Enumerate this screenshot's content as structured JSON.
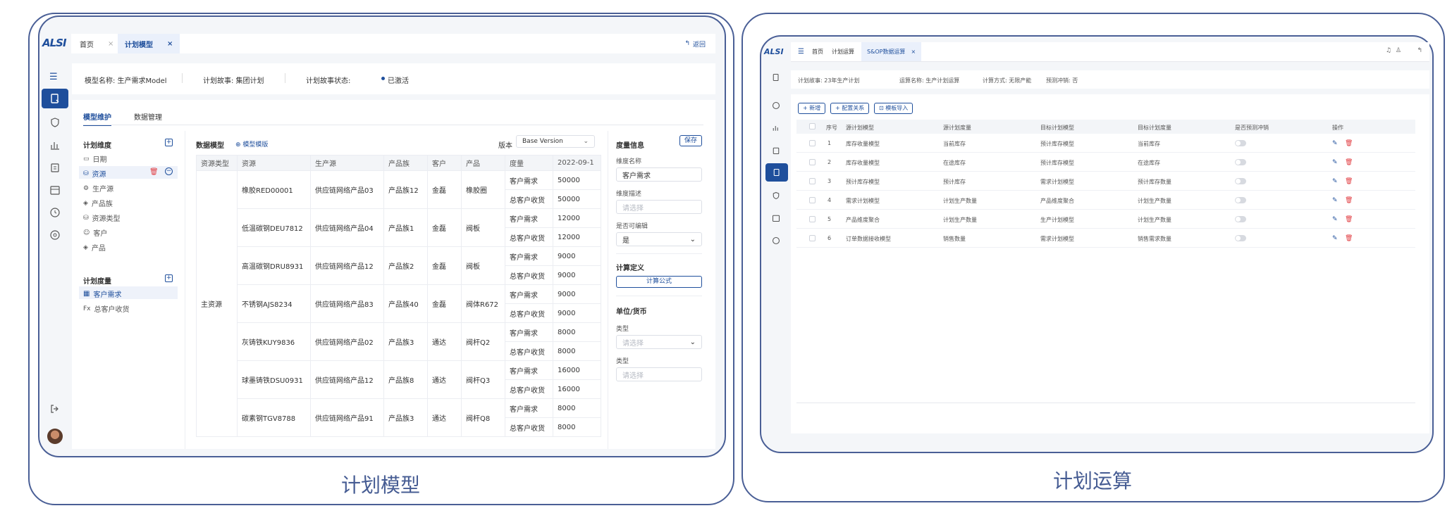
{
  "left": {
    "caption": "计划模型",
    "logo": "ALSI",
    "tabs": [
      {
        "label": "首页",
        "close": "×"
      },
      {
        "label": "计划模型",
        "close": "×"
      }
    ],
    "back_label": "返回",
    "info": {
      "model_name": "模型名称: 生产需求Model",
      "plan_story": "计划故事: 集团计划",
      "plan_status_label": "计划故事状态:",
      "plan_status_value": "已激活"
    },
    "subtabs": [
      "模型维护",
      "数据管理"
    ],
    "dimension": {
      "title": "计划维度",
      "items": [
        "日期",
        "资源",
        "生产源",
        "产品族",
        "资源类型",
        "客户",
        "产品"
      ],
      "icons": [
        "calendar-icon",
        "database-icon",
        "settings-icon",
        "tag-icon",
        "database-icon",
        "user-icon",
        "tag-icon"
      ]
    },
    "measure": {
      "title": "计划度量",
      "items": [
        "客户需求",
        "总客户收货"
      ],
      "prefix": [
        "",
        "Fx"
      ]
    },
    "data_model": {
      "title": "数据模型",
      "template_link": "模型模版",
      "version_label": "版本",
      "version_value": "Base Version",
      "columns": [
        "资源类型",
        "资源",
        "生产源",
        "产品族",
        "客户",
        "产品",
        "度量",
        "2022-09-1"
      ],
      "group_label": "主资源",
      "rows": [
        {
          "resource": "橡胶RED00001",
          "source": "供应链网络产品03",
          "family": "产品族12",
          "customer": "金磊",
          "product": "橡胶圈",
          "m1": "客户需求",
          "v1": "50000",
          "m2": "总客户收货",
          "v2": "50000"
        },
        {
          "resource": "低温碳钢DEU7812",
          "source": "供应链网络产品04",
          "family": "产品族1",
          "customer": "金磊",
          "product": "阀板",
          "m1": "客户需求",
          "v1": "12000",
          "m2": "总客户收货",
          "v2": "12000"
        },
        {
          "resource": "高温碳钢DRU8931",
          "source": "供应链网络产品12",
          "family": "产品族2",
          "customer": "金磊",
          "product": "阀板",
          "m1": "客户需求",
          "v1": "9000",
          "m2": "总客户收货",
          "v2": "9000"
        },
        {
          "resource": "不锈钢AJS8234",
          "source": "供应链网络产品83",
          "family": "产品族40",
          "customer": "金磊",
          "product": "阀体R672",
          "m1": "客户需求",
          "v1": "9000",
          "m2": "总客户收货",
          "v2": "9000"
        },
        {
          "resource": "灰铸铁KUY9836",
          "source": "供应链网络产品02",
          "family": "产品族3",
          "customer": "通达",
          "product": "阀杆Q2",
          "m1": "客户需求",
          "v1": "8000",
          "m2": "总客户收货",
          "v2": "8000"
        },
        {
          "resource": "球墨铸铁DSU0931",
          "source": "供应链网络产品12",
          "family": "产品族8",
          "customer": "通达",
          "product": "阀杆Q3",
          "m1": "客户需求",
          "v1": "16000",
          "m2": "总客户收货",
          "v2": "16000"
        },
        {
          "resource": "碳素钢TGV8788",
          "source": "供应链网络产品91",
          "family": "产品族3",
          "customer": "通达",
          "product": "阀杆Q8",
          "m1": "客户需求",
          "v1": "8000",
          "m2": "总客户收货",
          "v2": "8000"
        }
      ]
    },
    "measure_info": {
      "title": "度量信息",
      "save": "保存",
      "name_label": "维度名称",
      "name_value": "客户需求",
      "desc_label": "维度描述",
      "desc_placeholder": "请选择",
      "editable_label": "是否可编辑",
      "editable_value": "是",
      "calc_title": "计算定义",
      "calc_button": "计算公式",
      "unit_title": "单位/货币",
      "type_label": "类型",
      "type_placeholder": "请选择",
      "type2_label": "类型",
      "type2_placeholder": "请选择"
    }
  },
  "right": {
    "caption": "计划运算",
    "tabs": [
      "首页",
      "计划运算",
      "S&OP数据运算"
    ],
    "tab_close": "×",
    "info": {
      "story": "计划故事: 23年生产计划",
      "op_name": "运算名称: 生产计划运算",
      "method": "计算方式: 无限产能",
      "precheck": "预测冲销: 否"
    },
    "buttons": [
      "+ 新增",
      "+ 配置关系",
      "模板导入"
    ],
    "columns": [
      "序号",
      "源计划模型",
      "源计划度量",
      "目标计划模型",
      "目标计划度量",
      "是否预测冲销",
      "操作"
    ],
    "rows": [
      {
        "no": "1",
        "src_model": "库存收量模型",
        "src_measure": "当前库存",
        "tgt_model": "预计库存模型",
        "tgt_measure": "当前库存"
      },
      {
        "no": "2",
        "src_model": "库存收量模型",
        "src_measure": "在途库存",
        "tgt_model": "预计库存模型",
        "tgt_measure": "在途库存"
      },
      {
        "no": "3",
        "src_model": "预计库存模型",
        "src_measure": "预计库存",
        "tgt_model": "需求计划模型",
        "tgt_measure": "预计库存数量"
      },
      {
        "no": "4",
        "src_model": "需求计划模型",
        "src_measure": "计划生产数量",
        "tgt_model": "产品维度聚合",
        "tgt_measure": "计划生产数量"
      },
      {
        "no": "5",
        "src_model": "产品维度聚合",
        "src_measure": "计划生产数量",
        "tgt_model": "生产计划模型",
        "tgt_measure": "计划生产数量"
      },
      {
        "no": "6",
        "src_model": "订单数据接收模型",
        "src_measure": "销售数量",
        "tgt_model": "需求计划模型",
        "tgt_measure": "销售需求数量"
      }
    ]
  },
  "colors": {
    "accent": "#1f4f9c",
    "frame": "#4a5f96",
    "danger": "#e0393e"
  }
}
